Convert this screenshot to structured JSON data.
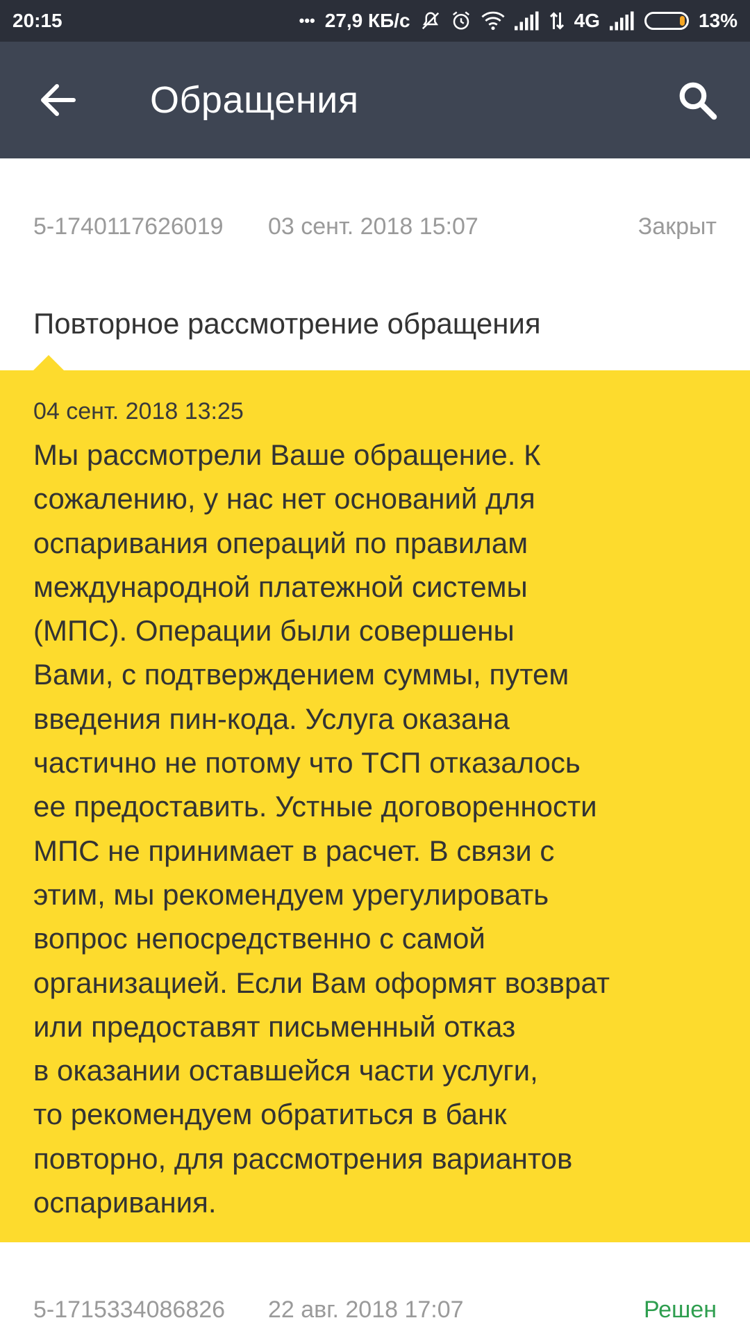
{
  "status_bar": {
    "time": "20:15",
    "dots": "•••",
    "speed": "27,9 КБ/с",
    "network": "4G",
    "battery": "13%",
    "battery_level": 0.13,
    "icons": [
      "mute-icon",
      "alarm-icon",
      "wifi-icon",
      "signal-icon",
      "data-arrows-icon",
      "signal-icon",
      "battery-icon"
    ]
  },
  "app_bar": {
    "title": "Обращения",
    "back_icon": "arrow-left-icon",
    "search_icon": "search-icon"
  },
  "tickets": [
    {
      "id": "5-1740117626019",
      "date": "03 сент. 2018 15:07",
      "status": "Закрыт",
      "subject": "Повторное рассмотрение обращения",
      "message": {
        "date": "04 сент. 2018 13:25",
        "lines": [
          "Мы рассмотрели Ваше обращение. К",
          "сожалению, у нас нет оснований для",
          "оспаривания операций по правилам",
          "международной платежной системы",
          "(МПС). Операции были совершены",
          "Вами, с подтверждением суммы, путем",
          "введения пин-кода. Услуга оказана",
          "частично не потому что ТСП отказалось",
          "ее предоставить. Устные договоренности",
          "МПС не принимает в расчет. В связи с",
          "этим, мы рекомендуем урегулировать",
          "вопрос непосредственно с самой",
          "организацией. Если Вам оформят возврат",
          "или предоставят письменный отказ",
          "в оказании оставшейся части услуги,",
          "то рекомендуем обратиться в банк",
          "повторно, для рассмотрения вариантов",
          "оспаривания."
        ]
      }
    },
    {
      "id": "5-1715334086826",
      "date": "22 авг. 2018 17:07",
      "status": "Решен"
    }
  ],
  "colors": {
    "status_bar_bg": "#2b2f39",
    "app_bar_bg": "#3e4553",
    "bubble_bg": "#fddb2d",
    "meta_text": "#9a9a9a",
    "resolved": "#2e9e4f",
    "battery_fill": "#f5a623"
  }
}
